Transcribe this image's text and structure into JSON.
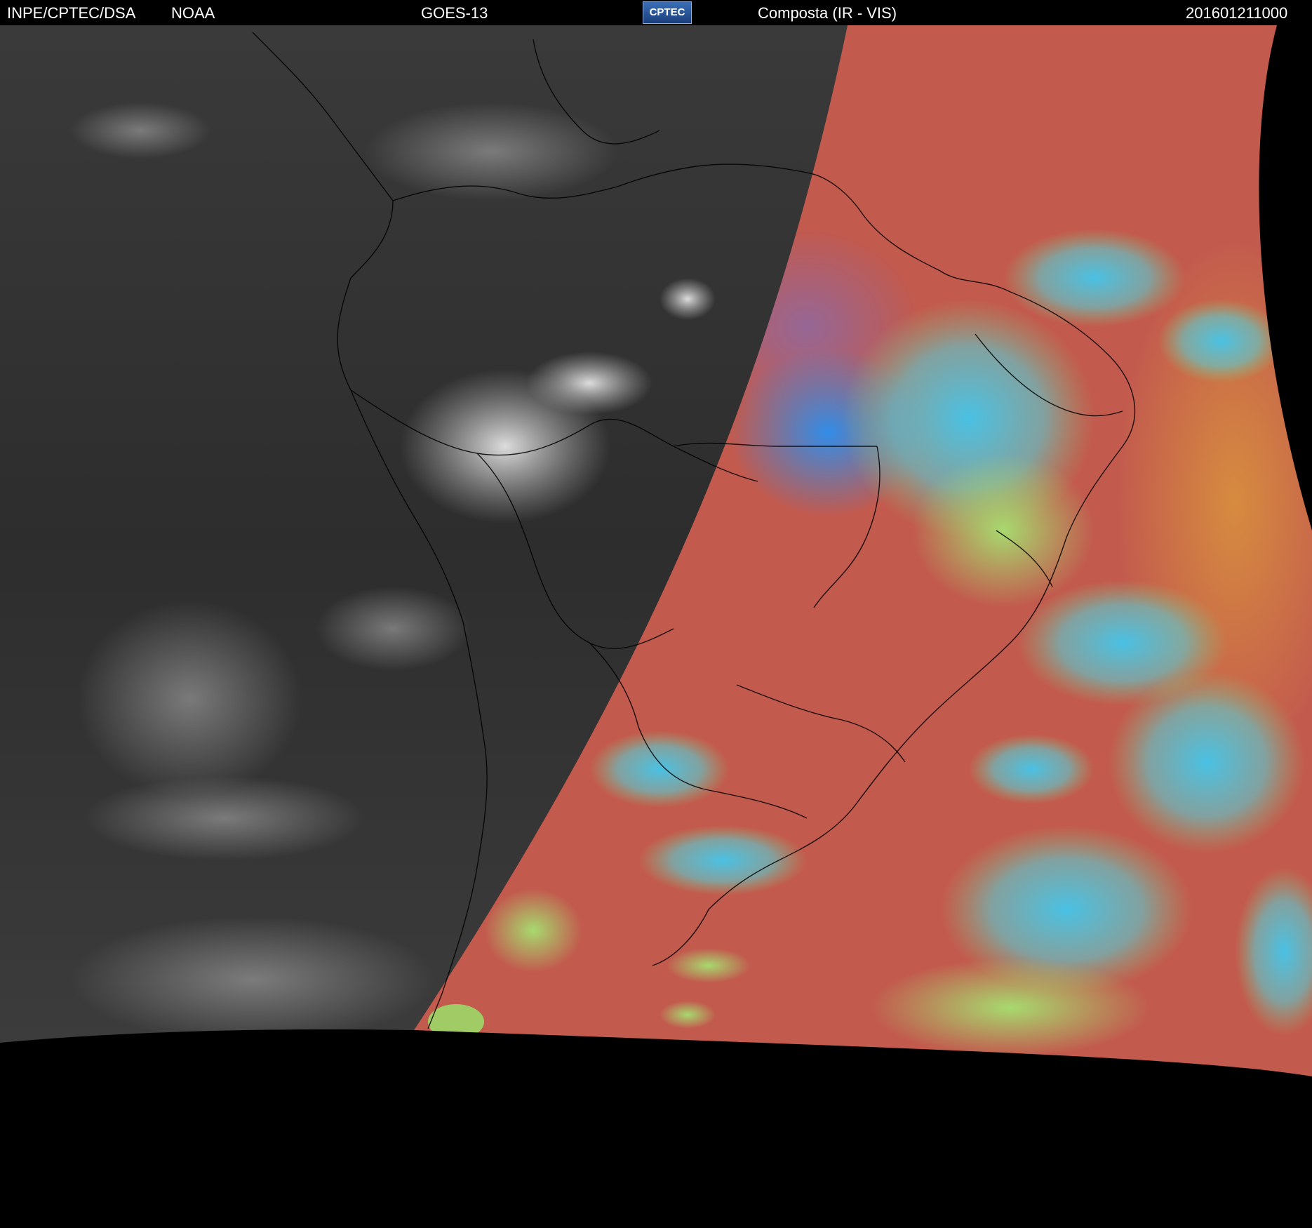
{
  "header": {
    "agency": "INPE/CPTEC/DSA",
    "partner": "NOAA",
    "satellite": "GOES-13",
    "logo_text": "CPTEC",
    "product": "Composta (IR - VIS)",
    "timestamp": "201601211000"
  },
  "colors": {
    "ir_dark": "#2e2e2e",
    "ir_cloud": "#bdbdbd",
    "vis_surface": "#c25a4e",
    "vis_cloud_cyan": "#3fc9e6",
    "vis_cloud_blue": "#2a8ff0",
    "vis_lowcloud_green": "#9be06a",
    "no_data": "#000000",
    "borders": "#000000"
  },
  "icons": [
    "cptec-logo"
  ]
}
